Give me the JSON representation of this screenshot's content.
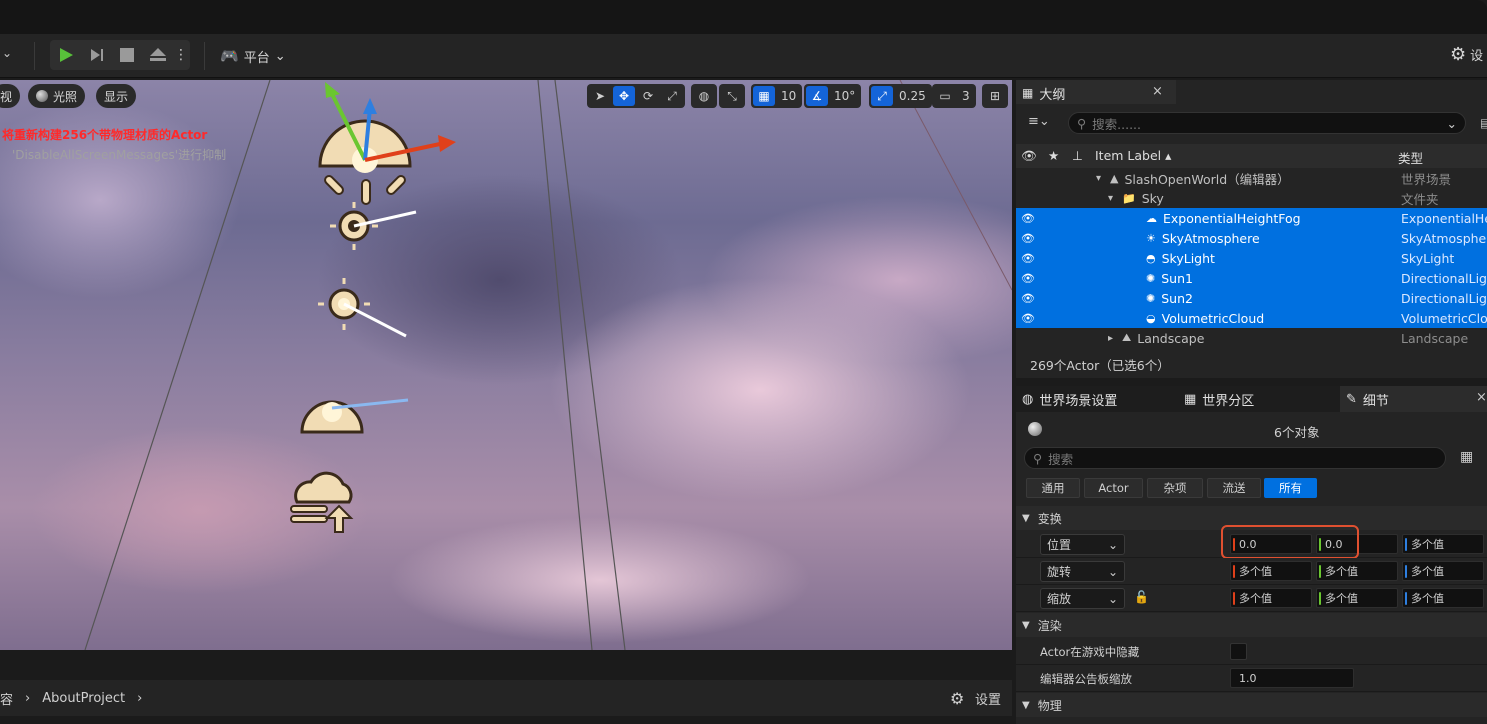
{
  "toolbar": {
    "platform_label": "平台",
    "settings_partial": "设"
  },
  "viewport": {
    "buttons": [
      "视",
      "光照",
      "显示"
    ],
    "grid_value": "10",
    "angle_value": "10°",
    "scale_value": "0.25",
    "camera_value": "3",
    "message_red": "将重新构建256个带物理材质的Actor",
    "message_grey": "'DisableAllScreenMessages'进行抑制"
  },
  "bottom": {
    "crumb_partial": "容",
    "crumb_project": "AboutProject",
    "settings_label": "设置"
  },
  "outliner": {
    "tab_title": "大纲",
    "search_placeholder": "搜索......",
    "col_label": "Item Label ▴",
    "col_type": "类型",
    "rows": [
      {
        "label": "SlashOpenWorld（编辑器）",
        "type": "世界场景"
      },
      {
        "label": "Sky",
        "type": "文件夹"
      },
      {
        "label": "ExponentialHeightFog",
        "type": "ExponentialHeightFog"
      },
      {
        "label": "SkyAtmosphere",
        "type": "SkyAtmosphere"
      },
      {
        "label": "SkyLight",
        "type": "SkyLight"
      },
      {
        "label": "Sun1",
        "type": "DirectionalLight"
      },
      {
        "label": "Sun2",
        "type": "DirectionalLight"
      },
      {
        "label": "VolumetricCloud",
        "type": "VolumetricCloud"
      },
      {
        "label": "Landscape",
        "type": "Landscape"
      }
    ],
    "status": "269个Actor（已选6个）"
  },
  "details": {
    "tabs": [
      "世界场景设置",
      "世界分区",
      "细节"
    ],
    "object_count": "6个对象",
    "search_placeholder": "搜索",
    "filters": [
      "通用",
      "Actor",
      "杂项",
      "流送",
      "所有"
    ],
    "section_transform": "变换",
    "location_label": "位置",
    "rotation_label": "旋转",
    "scale_label": "缩放",
    "location_values": [
      "0.0",
      "0.0",
      "多个值"
    ],
    "rotation_values": [
      "多个值",
      "多个值",
      "多个值"
    ],
    "scale_values": [
      "多个值",
      "多个值",
      "多个值"
    ],
    "section_render": "渲染",
    "hidden_in_game_label": "Actor在游戏中隐藏",
    "billboard_scale_label": "编辑器公告板缩放",
    "billboard_scale_value": "1.0",
    "section_physics": "物理"
  },
  "colors": {
    "accent": "#0070e0",
    "highlight": "#e05030",
    "x_axis": "#e0401a",
    "y_axis": "#6ac630",
    "z_axis": "#2e7fe0"
  }
}
